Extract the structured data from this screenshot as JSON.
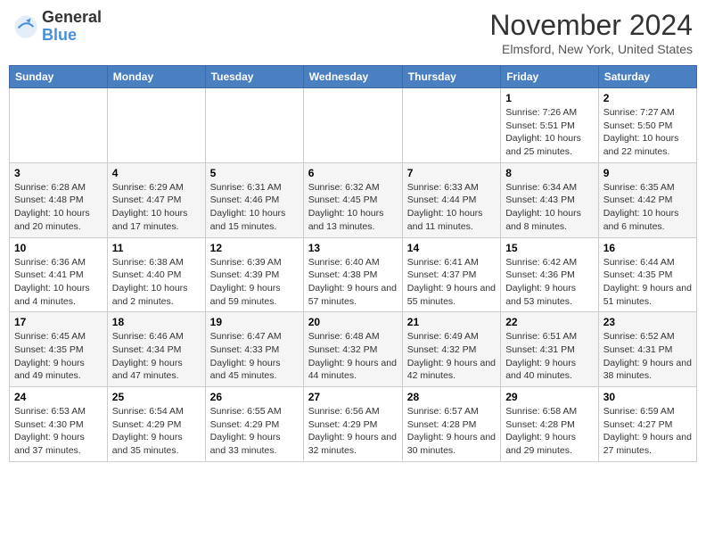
{
  "header": {
    "logo_general": "General",
    "logo_blue": "Blue",
    "month": "November 2024",
    "location": "Elmsford, New York, United States"
  },
  "weekdays": [
    "Sunday",
    "Monday",
    "Tuesday",
    "Wednesday",
    "Thursday",
    "Friday",
    "Saturday"
  ],
  "weeks": [
    [
      {
        "day": "",
        "info": ""
      },
      {
        "day": "",
        "info": ""
      },
      {
        "day": "",
        "info": ""
      },
      {
        "day": "",
        "info": ""
      },
      {
        "day": "",
        "info": ""
      },
      {
        "day": "1",
        "info": "Sunrise: 7:26 AM\nSunset: 5:51 PM\nDaylight: 10 hours and 25 minutes."
      },
      {
        "day": "2",
        "info": "Sunrise: 7:27 AM\nSunset: 5:50 PM\nDaylight: 10 hours and 22 minutes."
      }
    ],
    [
      {
        "day": "3",
        "info": "Sunrise: 6:28 AM\nSunset: 4:48 PM\nDaylight: 10 hours and 20 minutes."
      },
      {
        "day": "4",
        "info": "Sunrise: 6:29 AM\nSunset: 4:47 PM\nDaylight: 10 hours and 17 minutes."
      },
      {
        "day": "5",
        "info": "Sunrise: 6:31 AM\nSunset: 4:46 PM\nDaylight: 10 hours and 15 minutes."
      },
      {
        "day": "6",
        "info": "Sunrise: 6:32 AM\nSunset: 4:45 PM\nDaylight: 10 hours and 13 minutes."
      },
      {
        "day": "7",
        "info": "Sunrise: 6:33 AM\nSunset: 4:44 PM\nDaylight: 10 hours and 11 minutes."
      },
      {
        "day": "8",
        "info": "Sunrise: 6:34 AM\nSunset: 4:43 PM\nDaylight: 10 hours and 8 minutes."
      },
      {
        "day": "9",
        "info": "Sunrise: 6:35 AM\nSunset: 4:42 PM\nDaylight: 10 hours and 6 minutes."
      }
    ],
    [
      {
        "day": "10",
        "info": "Sunrise: 6:36 AM\nSunset: 4:41 PM\nDaylight: 10 hours and 4 minutes."
      },
      {
        "day": "11",
        "info": "Sunrise: 6:38 AM\nSunset: 4:40 PM\nDaylight: 10 hours and 2 minutes."
      },
      {
        "day": "12",
        "info": "Sunrise: 6:39 AM\nSunset: 4:39 PM\nDaylight: 9 hours and 59 minutes."
      },
      {
        "day": "13",
        "info": "Sunrise: 6:40 AM\nSunset: 4:38 PM\nDaylight: 9 hours and 57 minutes."
      },
      {
        "day": "14",
        "info": "Sunrise: 6:41 AM\nSunset: 4:37 PM\nDaylight: 9 hours and 55 minutes."
      },
      {
        "day": "15",
        "info": "Sunrise: 6:42 AM\nSunset: 4:36 PM\nDaylight: 9 hours and 53 minutes."
      },
      {
        "day": "16",
        "info": "Sunrise: 6:44 AM\nSunset: 4:35 PM\nDaylight: 9 hours and 51 minutes."
      }
    ],
    [
      {
        "day": "17",
        "info": "Sunrise: 6:45 AM\nSunset: 4:35 PM\nDaylight: 9 hours and 49 minutes."
      },
      {
        "day": "18",
        "info": "Sunrise: 6:46 AM\nSunset: 4:34 PM\nDaylight: 9 hours and 47 minutes."
      },
      {
        "day": "19",
        "info": "Sunrise: 6:47 AM\nSunset: 4:33 PM\nDaylight: 9 hours and 45 minutes."
      },
      {
        "day": "20",
        "info": "Sunrise: 6:48 AM\nSunset: 4:32 PM\nDaylight: 9 hours and 44 minutes."
      },
      {
        "day": "21",
        "info": "Sunrise: 6:49 AM\nSunset: 4:32 PM\nDaylight: 9 hours and 42 minutes."
      },
      {
        "day": "22",
        "info": "Sunrise: 6:51 AM\nSunset: 4:31 PM\nDaylight: 9 hours and 40 minutes."
      },
      {
        "day": "23",
        "info": "Sunrise: 6:52 AM\nSunset: 4:31 PM\nDaylight: 9 hours and 38 minutes."
      }
    ],
    [
      {
        "day": "24",
        "info": "Sunrise: 6:53 AM\nSunset: 4:30 PM\nDaylight: 9 hours and 37 minutes."
      },
      {
        "day": "25",
        "info": "Sunrise: 6:54 AM\nSunset: 4:29 PM\nDaylight: 9 hours and 35 minutes."
      },
      {
        "day": "26",
        "info": "Sunrise: 6:55 AM\nSunset: 4:29 PM\nDaylight: 9 hours and 33 minutes."
      },
      {
        "day": "27",
        "info": "Sunrise: 6:56 AM\nSunset: 4:29 PM\nDaylight: 9 hours and 32 minutes."
      },
      {
        "day": "28",
        "info": "Sunrise: 6:57 AM\nSunset: 4:28 PM\nDaylight: 9 hours and 30 minutes."
      },
      {
        "day": "29",
        "info": "Sunrise: 6:58 AM\nSunset: 4:28 PM\nDaylight: 9 hours and 29 minutes."
      },
      {
        "day": "30",
        "info": "Sunrise: 6:59 AM\nSunset: 4:27 PM\nDaylight: 9 hours and 27 minutes."
      }
    ]
  ]
}
